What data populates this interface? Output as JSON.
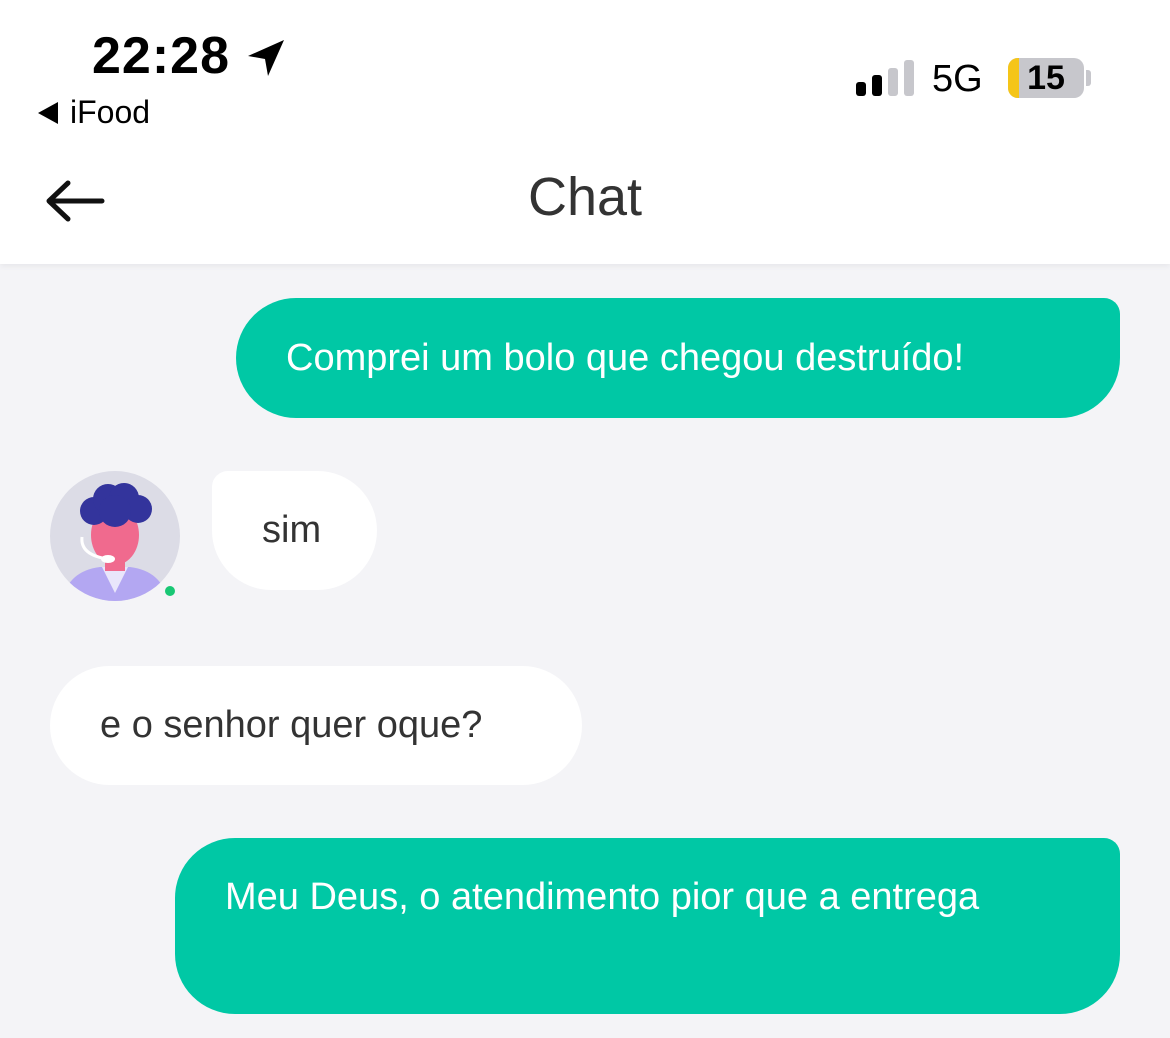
{
  "status_bar": {
    "time": "22:28",
    "back_app": "iFood",
    "network": "5G",
    "battery": "15",
    "battery_level": 0.15
  },
  "header": {
    "title": "Chat"
  },
  "messages": [
    {
      "from": "user",
      "text": "Comprei um bolo que chegou destruído!"
    },
    {
      "from": "agent",
      "text": "sim"
    },
    {
      "from": "agent",
      "text": "e o senhor quer oque?"
    },
    {
      "from": "user",
      "text": "Meu Deus, o atendimento pior que a entrega"
    }
  ],
  "colors": {
    "outgoing_bubble": "#00c8a5",
    "incoming_bubble": "#ffffff",
    "background": "#f4f4f7",
    "online": "#18c774"
  }
}
